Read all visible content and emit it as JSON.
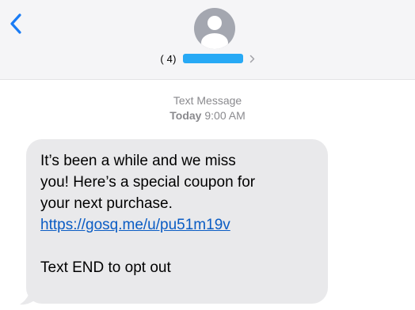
{
  "header": {
    "back_icon": "chevron-left-icon",
    "avatar_icon": "person-silhouette-icon",
    "contact_number_visible": "(   4)",
    "contact_chevron_icon": "chevron-right-icon"
  },
  "meta": {
    "label": "Text Message",
    "day": "Today",
    "time": "9:00 AM"
  },
  "message": {
    "line1": "It’s been a while and we miss",
    "line2": "you! Here’s a special coupon for",
    "line3": "your next purchase.",
    "link": "https://gosq.me/u/pu51m19v",
    "optout": "Text END to opt out"
  },
  "colors": {
    "header_bg": "#f5f5f7",
    "ios_blue": "#1a7cf5",
    "link_blue": "#0a5cc4",
    "bubble_gray": "#e9e9eb",
    "meta_gray": "#8a8a8e",
    "redaction_blue": "#27a9f5"
  }
}
